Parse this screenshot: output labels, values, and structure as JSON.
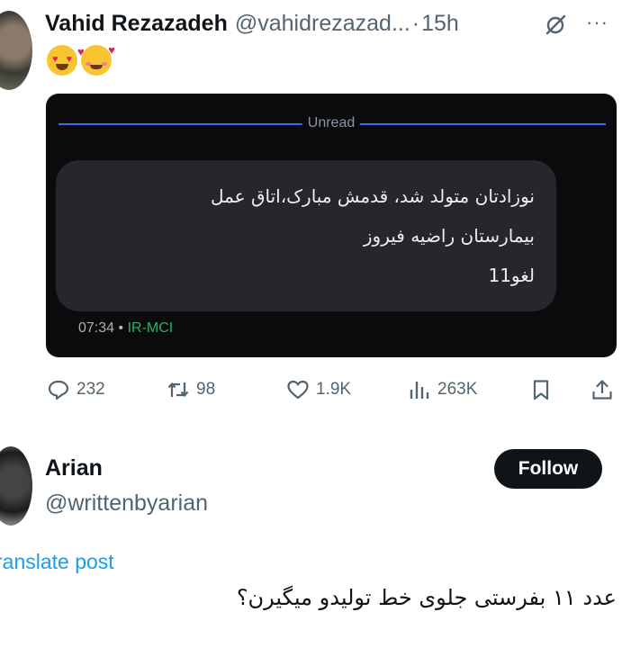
{
  "post": {
    "author_name": "Vahid Rezazadeh",
    "handle": "@vahidrezazad...",
    "dot": "·",
    "time": "15h",
    "emojis": [
      "heart-eyes-emoji",
      "smiling-face-with-hearts-emoji"
    ],
    "media": {
      "unread_label": "Unread",
      "message": "نوزادتان متولد شد، قدمش مبارک،اتاق عمل\nبیمارستان راضیه فیروز\nلغو11",
      "sms_time": "07:34",
      "sms_separator": "•",
      "carrier": "IR-MCI"
    },
    "actions": {
      "replies": "232",
      "reposts": "98",
      "likes": "1.9K",
      "views": "263K"
    }
  },
  "reply": {
    "author_name": "Arian",
    "handle": "@writtenbyarian",
    "follow_label": "Follow",
    "translate_label": "ranslate post",
    "text": "عدد ۱۱ بفرستی جلوی خط تولیدو میگیرن؟"
  },
  "colors": {
    "text_primary": "#0f1419",
    "text_secondary": "#536471",
    "link": "#1d9bf0",
    "unread_line": "#3d6ee8",
    "carrier": "#2fae6b"
  }
}
